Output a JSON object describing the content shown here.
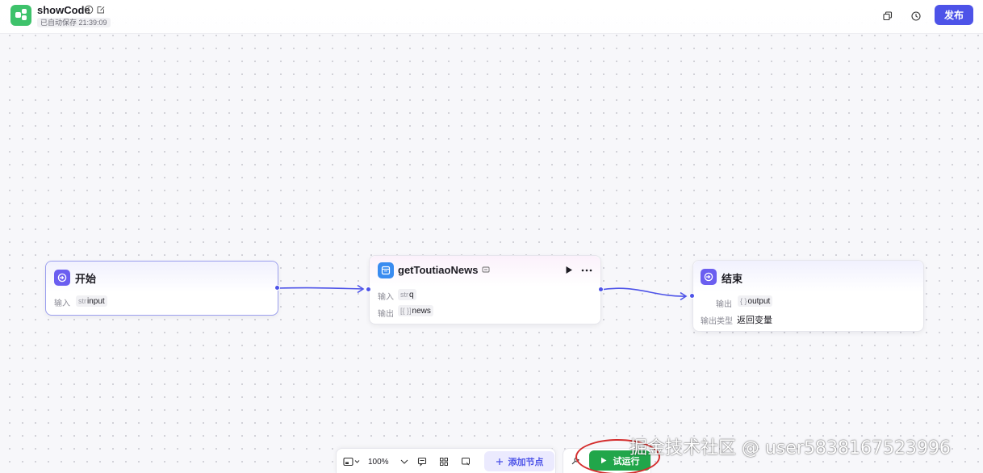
{
  "header": {
    "title": "showCode",
    "autosave": "已自动保存 21:39:09",
    "publish_label": "发布"
  },
  "nodes": {
    "start": {
      "title": "开始",
      "input_label": "输入",
      "input_type": "str",
      "input_name": "input"
    },
    "code": {
      "title": "getToutiaoNews",
      "input_label": "输入",
      "input_type": "str",
      "input_name": "q",
      "output_label": "输出",
      "output_type": "[{ }]",
      "output_name": "news"
    },
    "end": {
      "title": "结束",
      "output_label": "输出",
      "output_type": "{ }",
      "output_name": "output",
      "output_kind_label": "输出类型",
      "output_kind_value": "返回变量"
    }
  },
  "toolbar": {
    "zoom": "100%",
    "add_node_label": "添加节点",
    "test_run_label": "试运行"
  },
  "watermark": "掘金技术社区 @ user5838167523996",
  "colors": {
    "accent": "#4d53e8",
    "run_green": "#21a64a",
    "logo_green": "#3ec26b",
    "annotation_red": "#d42d2d"
  }
}
